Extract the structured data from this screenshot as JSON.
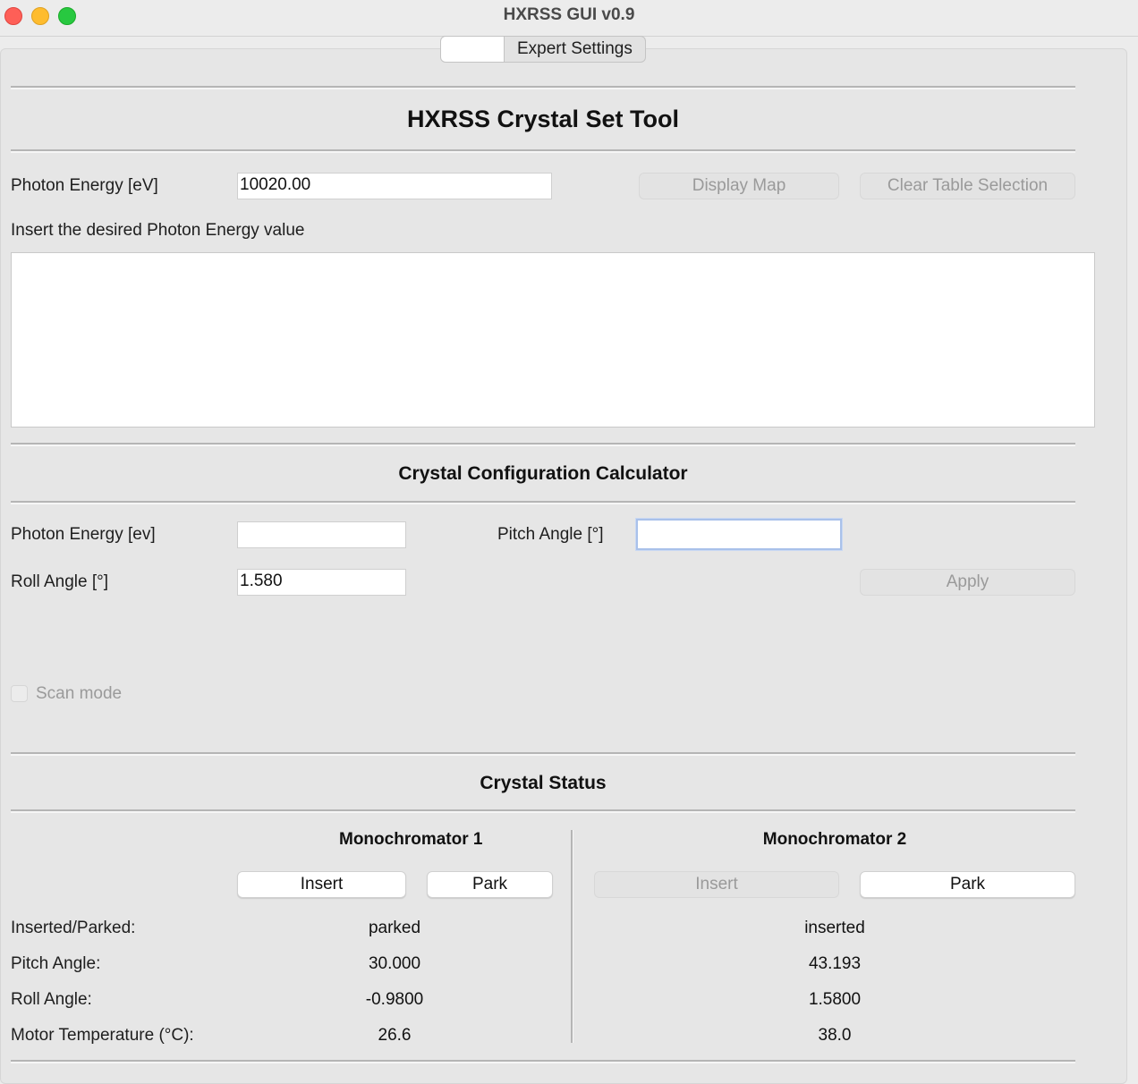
{
  "window": {
    "title": "HXRSS GUI v0.9"
  },
  "tabs": {
    "first": "",
    "second": "Expert Settings"
  },
  "main": {
    "title": "HXRSS Crystal Set Tool",
    "photon_energy_label": "Photon Energy [eV]",
    "photon_energy_value": "10020.00",
    "display_map_label": "Display Map",
    "clear_table_label": "Clear Table Selection",
    "instruction": "Insert the desired Photon Energy value"
  },
  "calculator": {
    "title": "Crystal Configuration Calculator",
    "photon_energy_label": "Photon Energy [ev]",
    "photon_energy_value": "",
    "pitch_label": "Pitch Angle [°]",
    "pitch_value": "",
    "roll_label": "Roll Angle [°]",
    "roll_value": "1.580",
    "apply_label": "Apply",
    "scan_mode_label": "Scan mode",
    "scan_mode_checked": false
  },
  "status": {
    "title": "Crystal Status",
    "rows": [
      "Inserted/Parked:",
      "Pitch Angle:",
      "Roll Angle:",
      "Motor Temperature (°C):"
    ],
    "mono1": {
      "title": "Monochromator 1",
      "insert_label": "Insert",
      "park_label": "Park",
      "values": [
        "parked",
        "30.000",
        "-0.9800",
        "26.6"
      ]
    },
    "mono2": {
      "title": "Monochromator 2",
      "insert_label": "Insert",
      "park_label": "Park",
      "values": [
        "inserted",
        "43.193",
        "1.5800",
        "38.0"
      ]
    }
  }
}
